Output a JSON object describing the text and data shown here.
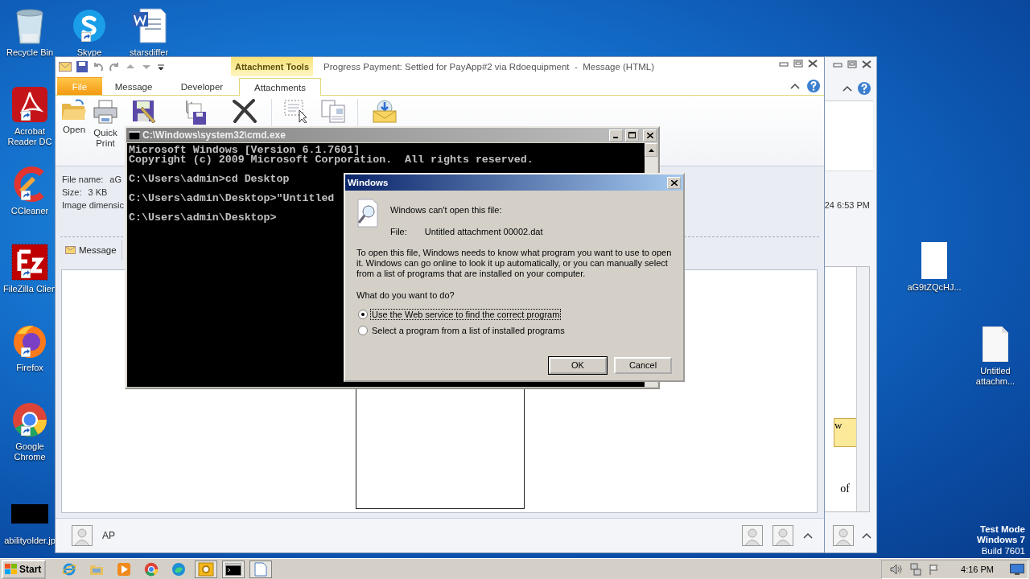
{
  "desktop_icons": [
    {
      "label": "Recycle Bin",
      "kind": "recycle",
      "shortcut": false
    },
    {
      "label": "Skype",
      "kind": "skype",
      "shortcut": true
    },
    {
      "label": "starsdiffer",
      "kind": "word",
      "shortcut": false
    },
    {
      "label": "Acrobat Reader DC",
      "kind": "acrobat",
      "shortcut": true
    },
    {
      "label": "CCleaner",
      "kind": "ccleaner",
      "shortcut": true
    },
    {
      "label": "FileZilla Clien",
      "kind": "filezilla",
      "shortcut": true
    },
    {
      "label": "Firefox",
      "kind": "firefox",
      "shortcut": true
    },
    {
      "label": "Google Chrome",
      "kind": "chrome",
      "shortcut": true
    },
    {
      "label": "abilityolder.jp",
      "kind": "image",
      "shortcut": false
    },
    {
      "label": "aG9tZQcHJ...",
      "kind": "blank",
      "shortcut": false
    },
    {
      "label": "Untitled attachm...",
      "kind": "file",
      "shortcut": false
    }
  ],
  "back_window": {
    "date": "24 6:53 PM",
    "box_text": "w",
    "body_text": "of"
  },
  "outlook": {
    "title": "Progress Payment: Settled for PayApp#2 via Rdoequipment  -  Message (HTML)",
    "context_tab": "Attachment Tools",
    "tabs": [
      {
        "label": "File",
        "kind": "file",
        "selected": false
      },
      {
        "label": "Message",
        "kind": "plain",
        "selected": false
      },
      {
        "label": "Developer",
        "kind": "plain",
        "selected": false
      },
      {
        "label": "Attachments",
        "kind": "plain",
        "selected": true
      }
    ],
    "ribbon": [
      {
        "kind": "open",
        "label": "Open"
      },
      {
        "kind": "print",
        "label": "Quick Print"
      },
      {
        "kind": "save"
      },
      {
        "kind": "saveall"
      },
      {
        "kind": "remove"
      },
      {
        "kind": "select"
      },
      {
        "kind": "copy"
      },
      {
        "kind": "mail"
      }
    ],
    "info": [
      {
        "label": "File name:",
        "value": "aG"
      },
      {
        "label": "Size:",
        "value": "3 KB"
      },
      {
        "label": "Image dimensic"
      }
    ],
    "message_tab": "Message",
    "sender": "AP"
  },
  "cmd": {
    "title": "C:\\Windows\\system32\\cmd.exe",
    "blocks": [
      [
        "Microsoft Windows [Version 6.1.7601]",
        "Copyright (c) 2009 Microsoft Corporation.  All rights reserved."
      ],
      [
        "C:\\Users\\admin>cd Desktop"
      ],
      [
        "C:\\Users\\admin\\Desktop>\"Untitled"
      ],
      [
        "C:\\Users\\admin\\Desktop>"
      ]
    ]
  },
  "dialog": {
    "title": "Windows",
    "heading": "Windows can't open this file:",
    "file_label": "File:",
    "file_name": "Untitled attachment 00002.dat",
    "description": "To open this file, Windows needs to know what program you want to use to open it. Windows can go online to look it up automatically, or you can manually select from a list of programs that are installed on your computer.",
    "question": "What do you want to do?",
    "options": [
      {
        "label": "Use the Web service to find the correct program",
        "selected": true
      },
      {
        "label": "Select a program from a list of installed programs",
        "selected": false
      }
    ],
    "buttons": [
      {
        "label": "OK",
        "default": true
      },
      {
        "label": "Cancel",
        "default": false
      }
    ]
  },
  "watermark": {
    "line1": "Test Mode",
    "line2": "Windows 7",
    "line3": "Build 7601"
  },
  "taskbar": {
    "start": "Start",
    "items": [
      {
        "kind": "ie",
        "running": false
      },
      {
        "kind": "explorer",
        "running": false
      },
      {
        "kind": "media",
        "running": false
      },
      {
        "kind": "chrome",
        "running": false
      },
      {
        "kind": "edge",
        "running": false
      },
      {
        "kind": "outlook",
        "running": true
      },
      {
        "kind": "cmd",
        "running": true
      },
      {
        "kind": "document",
        "running": true
      }
    ],
    "clock": "4:16 PM"
  }
}
